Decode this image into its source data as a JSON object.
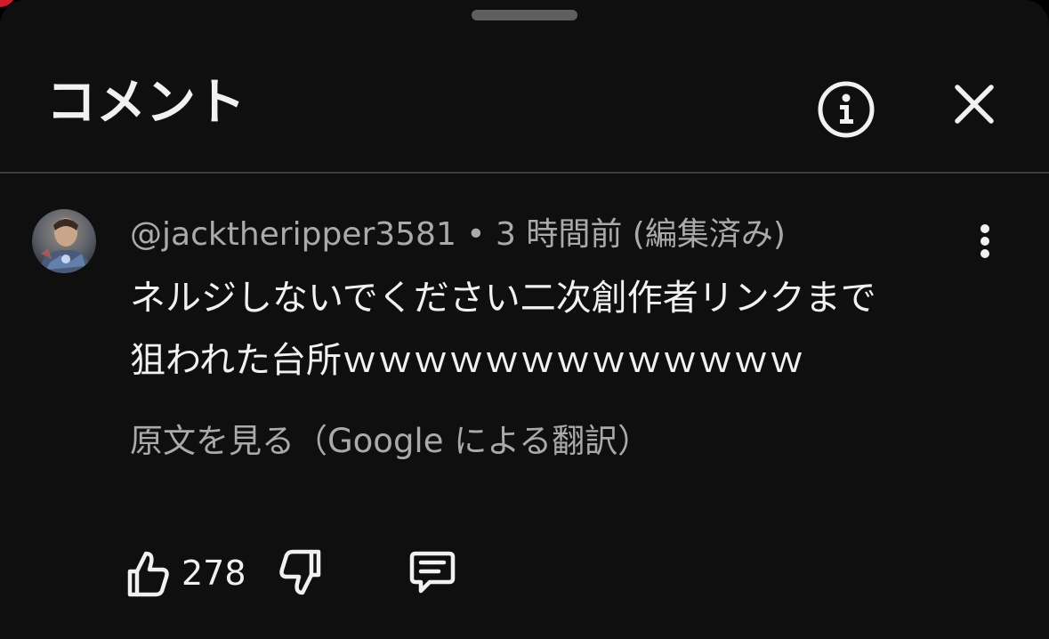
{
  "header": {
    "title": "コメント",
    "info_icon": "info-circle-icon",
    "close_icon": "close-icon"
  },
  "comment": {
    "author": "@jacktheripper3581",
    "separator": " • ",
    "timestamp": "3 時間前 (編集済み)",
    "text_lines": [
      "ネルジしないでください二次創作者リンクまで",
      "狙われた台所ｗｗｗｗｗｗｗｗｗｗｗｗｗ"
    ],
    "translation_link": "原文を見る（Google による翻訳）",
    "like_count": "278",
    "more_icon": "vertical-dots-icon",
    "like_icon": "thumbs-up-icon",
    "dislike_icon": "thumbs-down-icon",
    "reply_icon": "reply-bubble-icon"
  },
  "colors": {
    "background": "#0f0f0f",
    "primary_text": "#f1f1f1",
    "secondary_text": "#aaaaaa",
    "divider": "#3d3d3d",
    "notification_dot": "#d11a2a"
  }
}
